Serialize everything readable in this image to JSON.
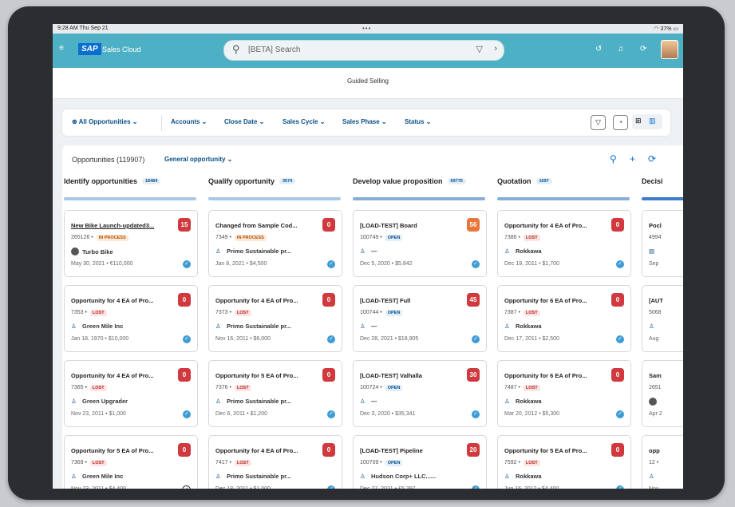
{
  "status_bar": {
    "time": "9:28 AM  Thu Sep 21",
    "dots": "•••",
    "battery": "37%"
  },
  "shell": {
    "menu_icon": "hamburger-icon",
    "logo": "SAP",
    "product": "Sales Cloud",
    "search_placeholder": "[BETA] Search",
    "icons": [
      "history-icon",
      "bell-icon",
      "refresh-icon"
    ]
  },
  "page_title": "Guided Selling",
  "filters": {
    "all": "All Opportunities",
    "items": [
      "Accounts",
      "Close Date",
      "Sales Cycle",
      "Sales Phase",
      "Status"
    ]
  },
  "board": {
    "title": "Opportunities (119907)",
    "view": "General opportunity",
    "columns": [
      {
        "name": "Identify opportunities",
        "count": "18484",
        "bar": "#a9c8e6",
        "cards": [
          {
            "title": "New Bike Launch-updated3...",
            "underline": true,
            "badge": "15",
            "badge_color": "red",
            "id": "265126",
            "status": "IN PROCESS",
            "status_type": "proc",
            "account": "Turbo Bike",
            "account_icon": "photo",
            "date": "May 30, 2021 • €110,000",
            "check": "filled"
          },
          {
            "title": "Opportunity for 4 EA of Pro...",
            "badge": "0",
            "badge_color": "red",
            "id": "7353",
            "status": "LOST",
            "status_type": "lost",
            "account": "Green Mile Inc",
            "account_icon": "person",
            "date": "Jan 18, 1970 • $10,000",
            "check": "filled"
          },
          {
            "title": "Opportunity for 4 EA of Pro...",
            "badge": "0",
            "badge_color": "red",
            "id": "7365",
            "status": "LOST",
            "status_type": "lost",
            "account": "Green Upgrader",
            "account_icon": "person",
            "date": "Nov 23, 2011 • $1,000",
            "check": "filled"
          },
          {
            "title": "Opportunity for 5 EA of Pro...",
            "badge": "0",
            "badge_color": "red",
            "id": "7369",
            "status": "LOST",
            "status_type": "lost",
            "account": "Green Mile Inc",
            "account_icon": "person",
            "date": "Nov 23, 2011 • $4,400",
            "check": "outline"
          }
        ]
      },
      {
        "name": "Qualify opportunity",
        "count": "3574",
        "bar": "#a9c8e6",
        "cards": [
          {
            "title": "Changed from Sample Cod...",
            "badge": "0",
            "badge_color": "red",
            "id": "7349",
            "status": "IN PROCESS",
            "status_type": "proc",
            "account": "Primo Sustainable pr...",
            "account_icon": "person",
            "date": "Jan 8, 2021 • $4,500",
            "check": "filled"
          },
          {
            "title": "Opportunity for 4 EA of Pro...",
            "badge": "0",
            "badge_color": "red",
            "id": "7373",
            "status": "LOST",
            "status_type": "lost",
            "account": "Primo Sustainable pr...",
            "account_icon": "person",
            "date": "Nov 16, 2011 • $6,000",
            "check": "filled"
          },
          {
            "title": "Opportunity for 5 EA of Pro...",
            "badge": "0",
            "badge_color": "red",
            "id": "7376",
            "status": "LOST",
            "status_type": "lost",
            "account": "Primo Sustainable pr...",
            "account_icon": "person",
            "date": "Dec 6, 2011 • $1,200",
            "check": "filled"
          },
          {
            "title": "Opportunity for 4 EA of Pro...",
            "badge": "0",
            "badge_color": "red",
            "id": "7417",
            "status": "LOST",
            "status_type": "lost",
            "account": "Primo Sustainable pr...",
            "account_icon": "person",
            "date": "Dec 18, 2011 • $1,000",
            "check": "filled"
          }
        ]
      },
      {
        "name": "Develop value proposition",
        "count": "69775",
        "bar": "#88aed6",
        "cards": [
          {
            "title": "[LOAD-TEST] Board",
            "badge": "56",
            "badge_color": "orange",
            "id": "100749",
            "status": "OPEN",
            "status_type": "open",
            "account": "—",
            "account_icon": "person",
            "date": "Dec 5, 2020 • $5,842",
            "check": "filled"
          },
          {
            "title": "[LOAD-TEST] Full",
            "badge": "45",
            "badge_color": "red",
            "id": "100744",
            "status": "OPEN",
            "status_type": "open",
            "account": "—",
            "account_icon": "person",
            "date": "Dec 28, 2021 • $18,905",
            "check": "filled"
          },
          {
            "title": "[LOAD-TEST] Valhalla",
            "badge": "30",
            "badge_color": "red",
            "id": "100724",
            "status": "OPEN",
            "status_type": "open",
            "account": "—",
            "account_icon": "person",
            "date": "Dec 3, 2020 • $35,341",
            "check": "filled"
          },
          {
            "title": "[LOAD-TEST] Pipeline",
            "badge": "20",
            "badge_color": "red",
            "id": "100709",
            "status": "OPEN",
            "status_type": "open",
            "account": "Hudson Corp+ LLC......",
            "account_icon": "person",
            "date": "Dec 27, 2021 • £5,297",
            "check": "filled"
          }
        ]
      },
      {
        "name": "Quotation",
        "count": "1697",
        "bar": "#88aed6",
        "cards": [
          {
            "title": "Opportunity for 4 EA of Pro...",
            "badge": "0",
            "badge_color": "red",
            "id": "7386",
            "status": "LOST",
            "status_type": "lost",
            "account": "Rokkawa",
            "account_icon": "person",
            "date": "Dec 19, 2011 • $1,700",
            "check": "filled"
          },
          {
            "title": "Opportunity for 6 EA of Pro...",
            "badge": "0",
            "badge_color": "red",
            "id": "7387",
            "status": "LOST",
            "status_type": "lost",
            "account": "Rokkawa",
            "account_icon": "person",
            "date": "Dec 17, 2011 • $2,500",
            "check": "filled"
          },
          {
            "title": "Opportunity for 6 EA of Pro...",
            "badge": "0",
            "badge_color": "red",
            "id": "7487",
            "status": "LOST",
            "status_type": "lost",
            "account": "Rokkawa",
            "account_icon": "person",
            "date": "Mar 20, 2012 • $5,300",
            "check": "filled"
          },
          {
            "title": "Opportunity for 5 EA of Pro...",
            "badge": "0",
            "badge_color": "red",
            "id": "7592",
            "status": "LOST",
            "status_type": "lost",
            "account": "Rokkawa",
            "account_icon": "person",
            "date": "Jun 16, 2012 • $4,400",
            "check": "filled"
          }
        ]
      },
      {
        "name": "Decisi",
        "count": "",
        "bar": "#3d7cc9",
        "cards": [
          {
            "title": "Pocl",
            "badge": "",
            "id": "4994",
            "status": "",
            "status_type": "",
            "account": "",
            "account_icon": "doc",
            "date": "Sep",
            "check": ""
          },
          {
            "title": "[AUT",
            "badge": "",
            "id": "5068",
            "status": "",
            "status_type": "",
            "account": "",
            "account_icon": "person",
            "date": "Aug",
            "check": ""
          },
          {
            "title": "Sam",
            "badge": "",
            "id": "2651",
            "status": "",
            "status_type": "",
            "account": "",
            "account_icon": "photo",
            "date": "Apr 2",
            "check": ""
          },
          {
            "title": "opp",
            "badge": "",
            "id": "12 •",
            "status": "",
            "status_type": "",
            "account": "",
            "account_icon": "person",
            "date": "Nov",
            "check": ""
          }
        ]
      }
    ]
  },
  "colors": {
    "shell": "#4db0c4",
    "accent": "#0a6ed1",
    "badge_red": "#d0393e",
    "badge_orange": "#e6763a"
  }
}
